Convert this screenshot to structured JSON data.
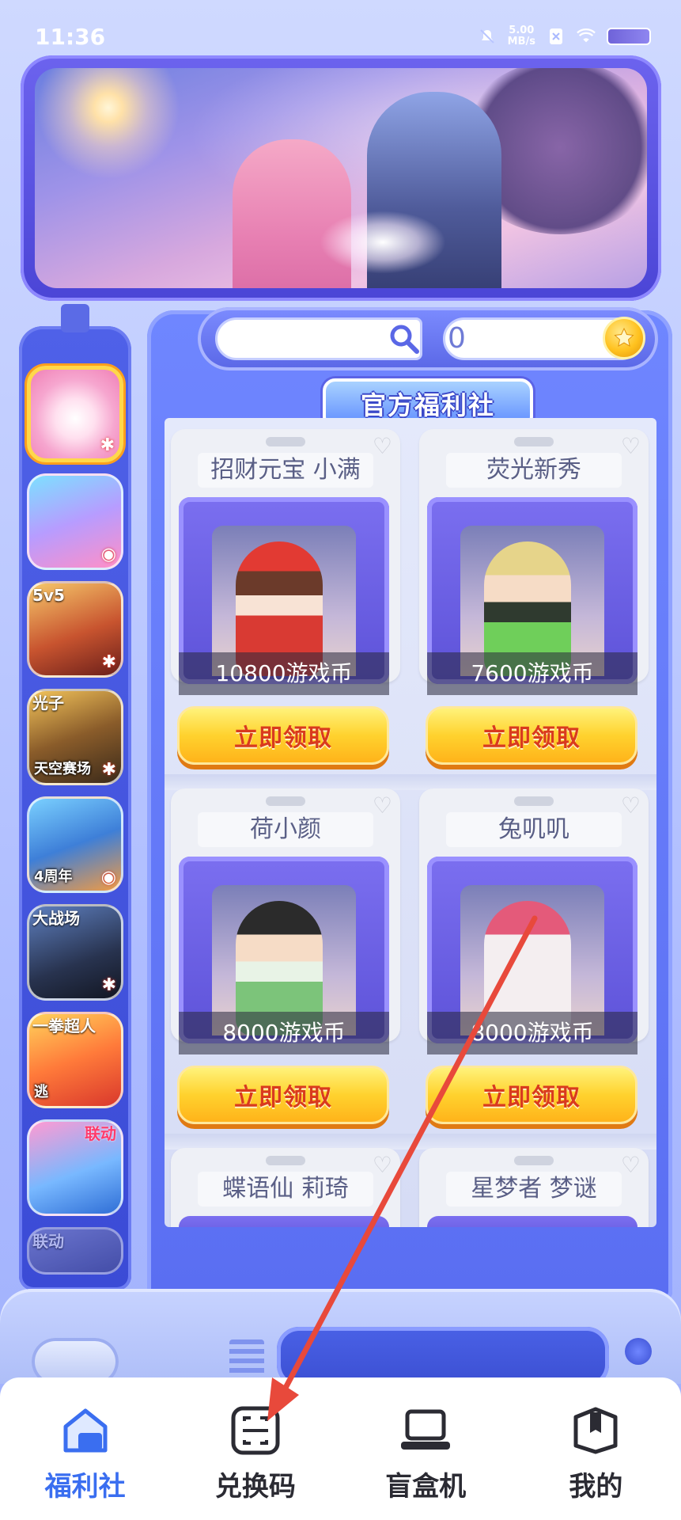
{
  "status_bar": {
    "time": "11:36",
    "net_speed_value": "5.00",
    "net_speed_unit": "MB/s"
  },
  "search": {
    "placeholder": ""
  },
  "coins": {
    "balance": "0"
  },
  "section_title": "官方福利社",
  "games": [
    {
      "icon": "game-icon-cute-mascot",
      "badge": "",
      "label": "",
      "selected": true
    },
    {
      "icon": "game-icon-egg-party",
      "badge": "",
      "label": ""
    },
    {
      "icon": "game-icon-honor-of-kings",
      "badge": "5v5",
      "label": ""
    },
    {
      "icon": "game-icon-pubg",
      "badge": "光子",
      "label": "天空赛场"
    },
    {
      "icon": "game-icon-tom-and-jerry",
      "badge": "",
      "label": "4周年"
    },
    {
      "icon": "game-icon-crossfire",
      "badge": "大战场",
      "label": ""
    },
    {
      "icon": "game-icon-escape",
      "badge": "一拳超人",
      "label": "逃"
    },
    {
      "icon": "game-icon-party-ball",
      "badge": "",
      "label": "联动"
    },
    {
      "icon": "game-icon-partial",
      "badge": "联动",
      "label": ""
    }
  ],
  "products": [
    {
      "name": "招财元宝 小满",
      "price": "10800游戏币",
      "button": "立即领取"
    },
    {
      "name": "荧光新秀",
      "price": "7600游戏币",
      "button": "立即领取"
    },
    {
      "name": "荷小颜",
      "price": "8000游戏币",
      "button": "立即领取"
    },
    {
      "name": "兔叽叽",
      "price": "8000游戏币",
      "button": "立即领取"
    },
    {
      "name": "蝶语仙 莉琦",
      "price": "",
      "button": ""
    },
    {
      "name": "星梦者 梦谜",
      "price": "",
      "button": ""
    }
  ],
  "nav": {
    "items": [
      {
        "label": "福利社",
        "icon": "home-shop-icon",
        "active": true
      },
      {
        "label": "兑换码",
        "icon": "scan-code-icon",
        "active": false
      },
      {
        "label": "盲盒机",
        "icon": "laptop-icon",
        "active": false
      },
      {
        "label": "我的",
        "icon": "gift-box-icon",
        "active": false
      }
    ]
  },
  "colors": {
    "accent": "#3a6ef0",
    "claim_text": "#d93a1e",
    "annotation_arrow": "#e8493b"
  }
}
